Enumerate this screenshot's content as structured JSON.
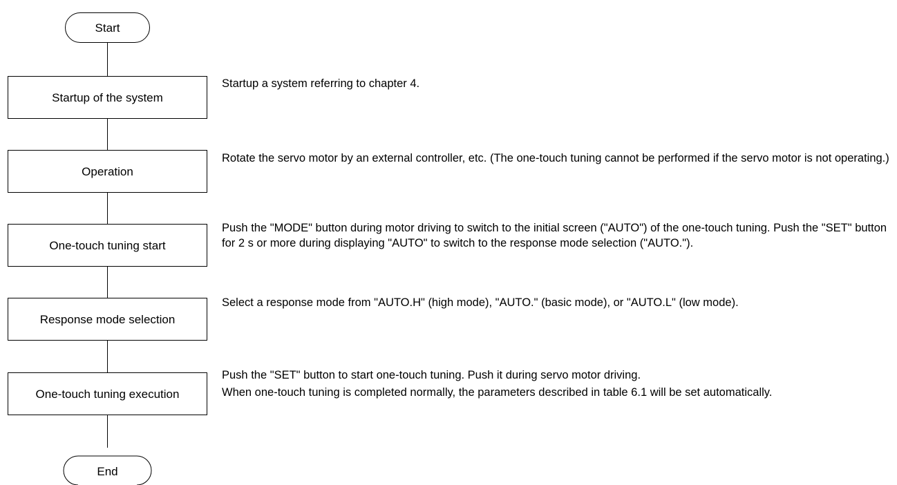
{
  "flowchart": {
    "start": "Start",
    "end": "End",
    "steps": [
      {
        "label": "Startup of the system",
        "description": [
          "Startup a system referring to chapter 4."
        ]
      },
      {
        "label": "Operation",
        "description": [
          "Rotate the servo motor by an external controller, etc. (The one-touch tuning cannot be performed if the servo motor is not operating.)"
        ]
      },
      {
        "label": "One-touch tuning start",
        "description": [
          "Push the \"MODE\" button during motor driving to switch to the initial screen (\"AUTO\") of the one-touch tuning. Push the \"SET\" button for 2 s or more during displaying \"AUTO\" to switch to the response mode selection (\"AUTO.\")."
        ]
      },
      {
        "label": "Response mode selection",
        "description": [
          "Select a response mode from \"AUTO.H\" (high mode), \"AUTO.\" (basic mode), or \"AUTO.L\" (low mode)."
        ]
      },
      {
        "label": "One-touch tuning execution",
        "description": [
          "Push the \"SET\" button to start one-touch tuning. Push it during servo motor driving.",
          "When one-touch tuning is completed normally, the parameters described in table 6.1 will be set automatically."
        ]
      }
    ]
  }
}
